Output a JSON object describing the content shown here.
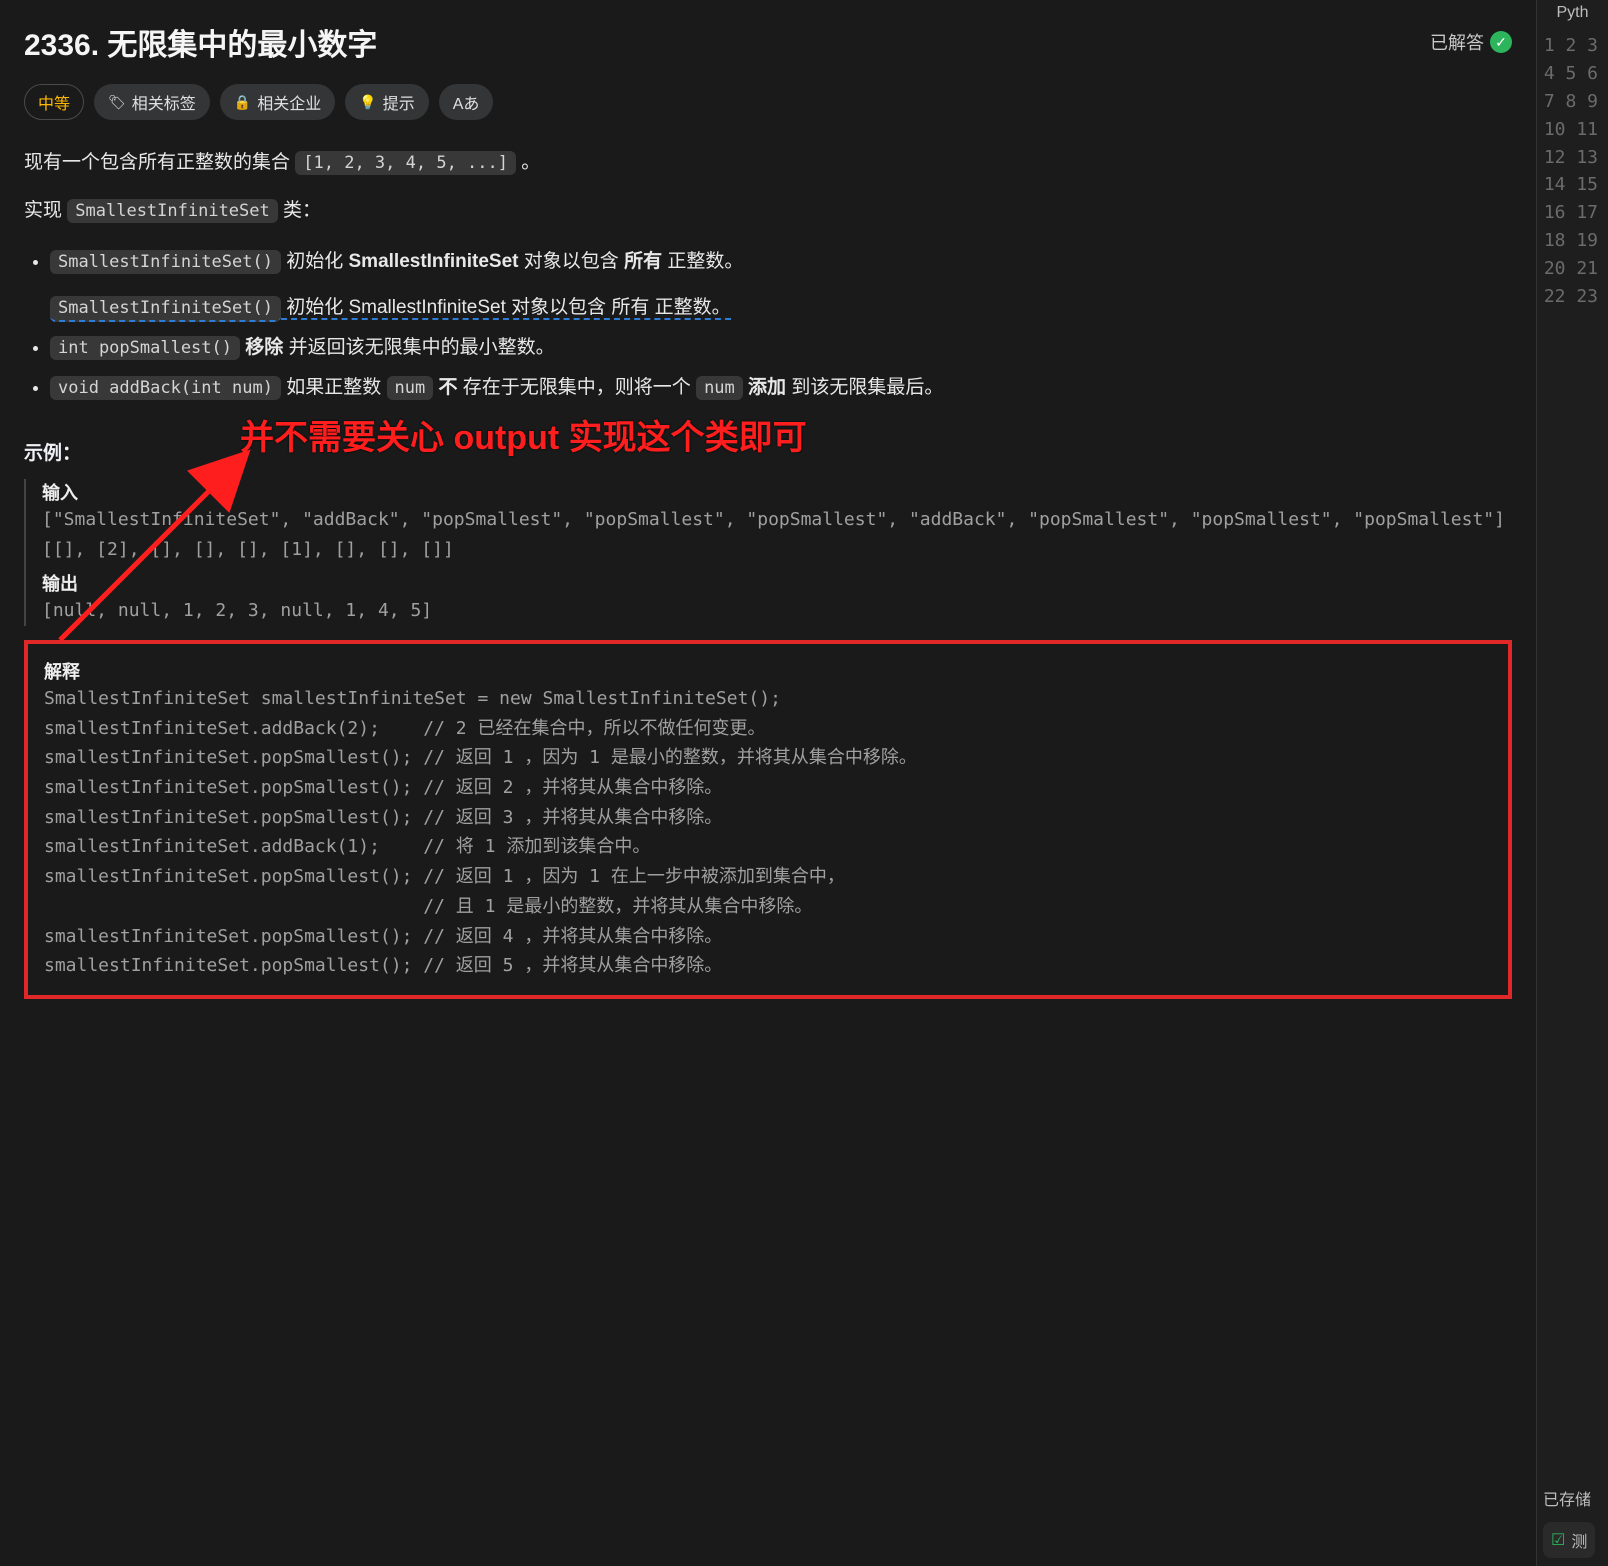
{
  "problem": {
    "title": "2336. 无限集中的最小数字",
    "solved_label": "已解答",
    "difficulty": "中等",
    "tags": {
      "related_tags": "相关标签",
      "related_companies": "相关企业",
      "hint": "提示",
      "translate": "Aあ"
    },
    "desc1_prefix": "现有一个包含所有正整数的集合 ",
    "desc1_code": "[1, 2, 3, 4, 5, ...]",
    "desc1_suffix": " 。",
    "desc2_prefix": "实现 ",
    "desc2_code": "SmallestInfiniteSet",
    "desc2_suffix": " 类：",
    "methods": [
      {
        "code": "SmallestInfiniteSet()",
        "text_before": "初始化 ",
        "bold": "SmallestInfiniteSet",
        "text_mid": " 对象以包含 ",
        "bold2": "所有",
        "text_after": " 正整数。",
        "dashed_dup": {
          "code": "SmallestInfiniteSet()",
          "plain": " 初始化 SmallestInfiniteSet 对象以包含 所有 正整数。"
        }
      },
      {
        "code": "int popSmallest()",
        "bold": "移除",
        "text_after": " 并返回该无限集中的最小整数。"
      },
      {
        "code": "void addBack(int num)",
        "text_before": "如果正整数 ",
        "code2": "num",
        "bold": " 不 ",
        "text_mid": "存在于无限集中，则将一个 ",
        "code3": "num",
        "bold2": " 添加 ",
        "text_after": "到该无限集最后。"
      }
    ],
    "example_label": "示例：",
    "input_label": "输入",
    "input_text": "[\"SmallestInfiniteSet\", \"addBack\", \"popSmallest\", \"popSmallest\", \"popSmallest\", \"addBack\", \"popSmallest\", \"popSmallest\", \"popSmallest\"]\n[[], [2], [], [], [], [1], [], [], []]",
    "output_label": "输出",
    "output_text": "[null, null, 1, 2, 3, null, 1, 4, 5]",
    "explain_label": "解释",
    "explain_text": "SmallestInfiniteSet smallestInfiniteSet = new SmallestInfiniteSet();\nsmallestInfiniteSet.addBack(2);    // 2 已经在集合中，所以不做任何变更。\nsmallestInfiniteSet.popSmallest(); // 返回 1 ，因为 1 是最小的整数，并将其从集合中移除。\nsmallestInfiniteSet.popSmallest(); // 返回 2 ，并将其从集合中移除。\nsmallestInfiniteSet.popSmallest(); // 返回 3 ，并将其从集合中移除。\nsmallestInfiniteSet.addBack(1);    // 将 1 添加到该集合中。\nsmallestInfiniteSet.popSmallest(); // 返回 1 ，因为 1 在上一步中被添加到集合中，\n                                   // 且 1 是最小的整数，并将其从集合中移除。\nsmallestInfiniteSet.popSmallest(); // 返回 4 ，并将其从集合中移除。\nsmallestInfiniteSet.popSmallest(); // 返回 5 ，并将其从集合中移除。"
  },
  "annotation": "并不需要关心 output 实现这个类即可",
  "right": {
    "language": "Pyth",
    "line_count": 23,
    "saved_label": "已存储",
    "test_label": "测"
  }
}
